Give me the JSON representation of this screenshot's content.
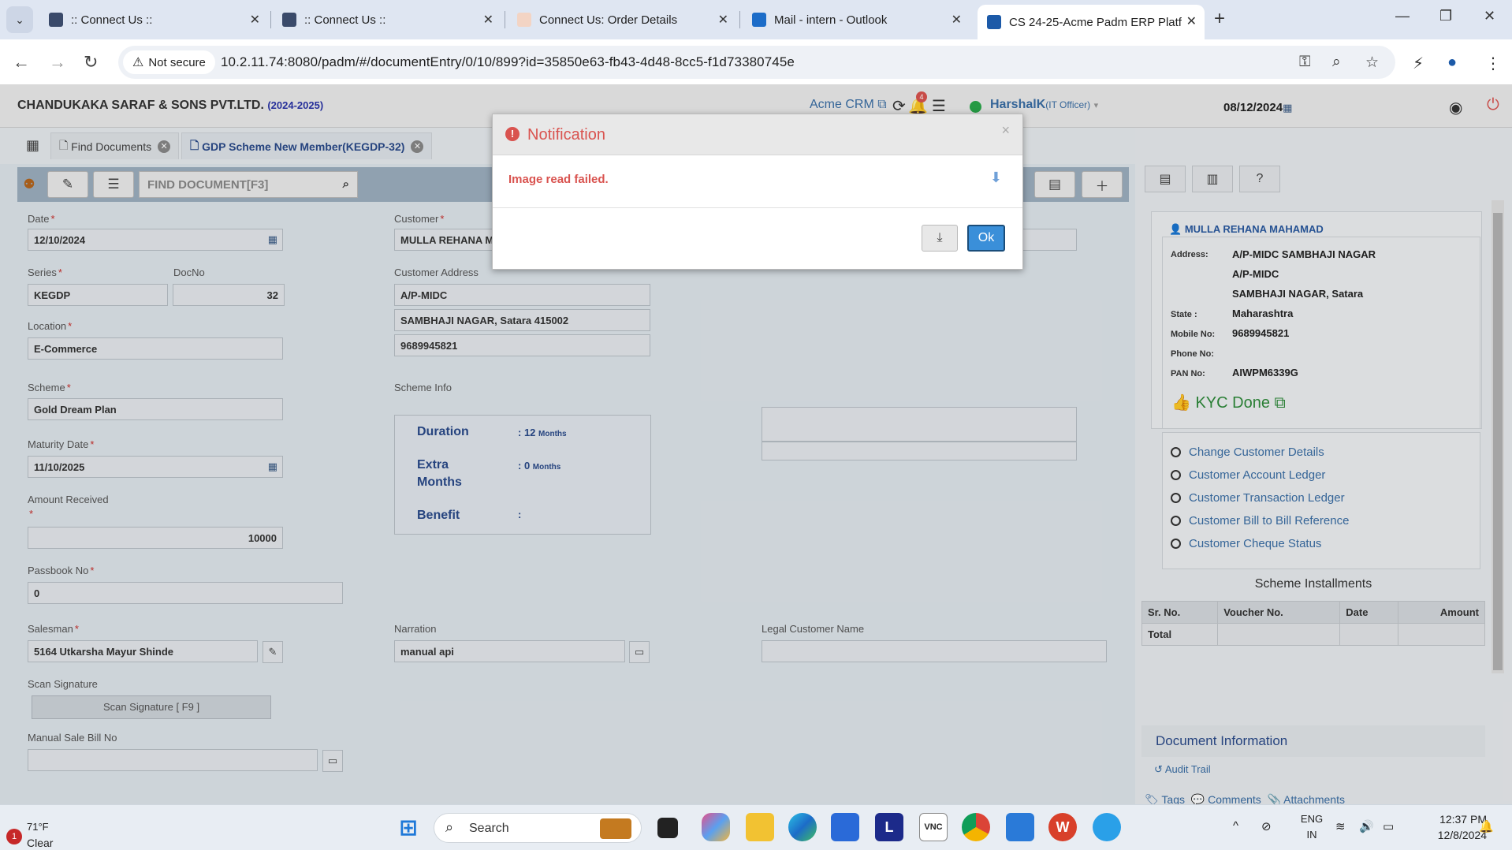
{
  "browser": {
    "tabs": [
      {
        "title": ":: Connect Us ::",
        "favicon_color": "#3a4a6a"
      },
      {
        "title": ":: Connect Us ::",
        "favicon_color": "#3a4a6a"
      },
      {
        "title": "Connect Us: Order Details",
        "favicon_color": "#f3d4c4"
      },
      {
        "title": "Mail - intern - Outlook",
        "favicon_color": "#1c6cc8"
      },
      {
        "title": "CS 24-25-Acme Padm ERP Platf",
        "favicon_color": "#1c5aa8"
      }
    ],
    "not_secure_label": "Not secure",
    "url": "10.2.11.74:8080/padm/#/documentEntry/0/10/899?id=35850e63-fb43-4d48-8cc5-f1d73380745e"
  },
  "header": {
    "company": "CHANDUKAKA SARAF & SONS PVT.LTD.",
    "year": "(2024-2025)",
    "crm_link": "Acme CRM",
    "notif_count": "4",
    "user": "HarshalK",
    "role": "(IT Officer)",
    "date": "08/12/2024"
  },
  "doc_tabs": {
    "find": "Find Documents",
    "active": "GDP Scheme New Member(KEGDP-32)"
  },
  "toolbar": {
    "find_placeholder": "FIND DOCUMENT[F3]"
  },
  "form": {
    "date_label": "Date",
    "date": "12/10/2024",
    "series_label": "Series",
    "series": "KEGDP",
    "docno_label": "DocNo",
    "docno": "32",
    "location_label": "Location",
    "location": "E-Commerce",
    "scheme_label": "Scheme",
    "scheme": "Gold Dream Plan",
    "maturity_label": "Maturity Date",
    "maturity": "11/10/2025",
    "amount_label": "Amount Received",
    "amount": "10000",
    "passbook_label": "Passbook No",
    "passbook": "0",
    "salesman_label": "Salesman",
    "salesman": "5164 Utkarsha Mayur Shinde",
    "scan_label": "Scan Signature",
    "scan_button": "Scan Signature [ F9 ]",
    "manual_label": "Manual Sale Bill No",
    "customer_label": "Customer",
    "customer": "MULLA REHANA M",
    "cust_addr_label": "Customer Address",
    "addr1": "A/P-MIDC",
    "addr2": "SAMBHAJI NAGAR, Satara 415002",
    "phone": "9689945821",
    "scheme_info_label": "Scheme Info",
    "duration_label": "Duration",
    "duration_val": ": 12",
    "duration_unit": "Months",
    "extra_label_1": "Extra",
    "extra_label_2": "Months",
    "extra_val": ": 0",
    "extra_unit": "Months",
    "benefit_label": "Benefit",
    "benefit_val": ":",
    "narration_label": "Narration",
    "narration": "manual api",
    "legal_label": "Legal Customer Name"
  },
  "customer_card": {
    "name": "MULLA REHANA MAHAMAD",
    "address_key": "Address:",
    "address_lines": [
      "A/P-MIDC SAMBHAJI NAGAR",
      "A/P-MIDC",
      "SAMBHAJI NAGAR, Satara"
    ],
    "state_key": "State :",
    "state": "Maharashtra",
    "mobile_key": "Mobile No:",
    "mobile": "9689945821",
    "phone_key": "Phone No:",
    "pan_key": "PAN No:",
    "pan": "AIWPM6339G",
    "kyc": "KYC Done"
  },
  "customer_links": [
    "Change Customer Details",
    "Customer Account Ledger",
    "Customer Transaction Ledger",
    "Customer Bill to Bill Reference",
    "Customer Cheque Status"
  ],
  "installments": {
    "title": "Scheme Installments",
    "columns": [
      "Sr. No.",
      "Voucher No.",
      "Date",
      "Amount"
    ],
    "total_label": "Total"
  },
  "doc_info": {
    "title": "Document Information",
    "audit": "Audit Trail",
    "tags": "Tags",
    "comments": "Comments",
    "attachments": "Attachments"
  },
  "modal": {
    "title": "Notification",
    "message": "Image read failed.",
    "ok": "Ok"
  },
  "taskbar": {
    "temp": "71°F",
    "condition": "Clear",
    "search": "Search",
    "lang1": "ENG",
    "lang2": "IN",
    "time": "12:37 PM",
    "date": "12/8/2024"
  }
}
